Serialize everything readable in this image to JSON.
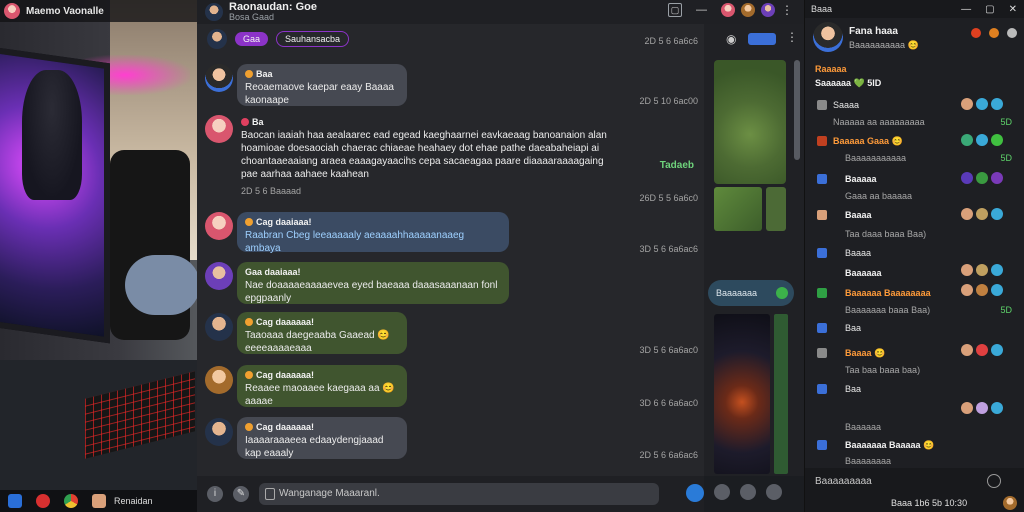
{
  "window": {
    "title": "Maemo Vaonalle"
  },
  "taskbar": {
    "app_label": "Renaidan"
  },
  "chat": {
    "title": "Raonaudan: Goe",
    "subtitle": "Bosa Gaad",
    "pinned": [
      "Gaa",
      "Sauhansacba"
    ],
    "pinned_time": "2D 5 6 6a6c6",
    "messages": [
      {
        "sender": "Baa",
        "text": "Reoaemaove kaepar eaay Baaaa\nkaonaape",
        "time": "2D 5 10 6ac00"
      },
      {
        "sender": "Ba",
        "text": "Baocan iaaiah haa aealaarec ead egead kaeghaarnei eavkaeaag banoanaion alan\nhoamioae doesaociah chaerac chiaeae heahaey dot ehae pathe daeabaheiapi ai\nchoantaaeaaiang araea eaaagayaacihs cepa sacaeagaa paare diaaaaraaaagaing\npae aarhaa aahaee kaahean",
        "link": "Tadaeb",
        "time_inline": "2D 5 6 Baaaad",
        "time": "26D 5 5 6a6c0"
      },
      {
        "sender": "Cag daaiaaa!",
        "text": "Raabran Cbeg leeaaaaaly aeaaaahhaaaaanaaeg ambaya",
        "time": "3D 5 6 6a6ac6"
      },
      {
        "sender": "Gaa daaiaaa!",
        "text": "Nae doaaaaeaaaaevea eyed baeaaa daaasaaanaan fonl\nepgpaanly",
        "time": ""
      },
      {
        "sender": "Cag daaaaaa!",
        "text": "Taaoaaa daegeaaba Gaaead 😊\neeeeaaaaeaaa",
        "time": "3D 5 6 6a6ac0"
      },
      {
        "sender": "Cag daaaaaa!",
        "text": "Reaaee maoaaee kaegaaa aa 😊\naaaae",
        "time": "3D 6 6 6a6ac0"
      },
      {
        "sender": "Cag daaaaaa!",
        "text": "Iaaaaraaaeea edaaydengjaaad\nkap eaaaly",
        "time": "2D 5 6 6a6ac6"
      }
    ],
    "composer_placeholder": "Wanganage Maaaranl."
  },
  "media": {
    "badge": "Baaaaaaa"
  },
  "sidebar": {
    "top_label": "Baaa",
    "profile": {
      "name": "Fana haaa",
      "status": "Baaaaaaaaaa 😊"
    },
    "section_title": "Raaaaa",
    "section_sub": "Saaaaaa 💚 5lD",
    "rows": [
      {
        "label": "Saaaa",
        "sub": "Naaaaa aa aaaaaaaaa",
        "count": "5D"
      },
      {
        "label": "Baaaaa Gaaa 😊",
        "sub": "Baaaaaaaaaaa",
        "count": "5D"
      },
      {
        "label": "Baaaaa",
        "sub": "Gaaa aa baaaaa",
        "count": ""
      },
      {
        "label": "Baaaa",
        "sub": "Taa daaa baaa Baa)",
        "count": ""
      },
      {
        "label": "Baaaa",
        "sub": "",
        "count": ""
      },
      {
        "label": "Baaaaaa Baaaaaaaa",
        "sub": "Baaaaaaa baaa Baa)",
        "count": "5D"
      },
      {
        "label": "Baa",
        "sub": "",
        "count": ""
      },
      {
        "label": "Baaaa 😊",
        "sub": "Taa baa baaa baa)",
        "count": ""
      },
      {
        "label": "Baa",
        "sub": "",
        "count": ""
      },
      {
        "label": "Baaaaaa",
        "sub": "Baaaaaa",
        "count": ""
      },
      {
        "label": "Baaaaaaa Baaaaa 😊",
        "sub": "Baaaaaaaa",
        "count": ""
      }
    ],
    "bottom_label": "Baaaaaaaaa",
    "clock": "Baaa 1b6 5b 10:30"
  }
}
